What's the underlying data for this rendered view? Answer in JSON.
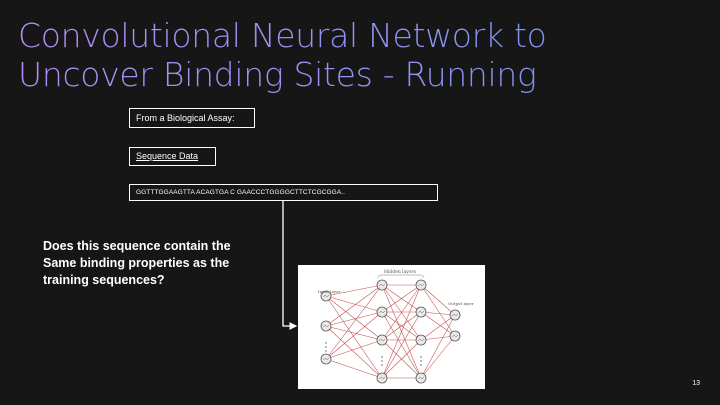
{
  "slide": {
    "title_line1": "Convolutional Neural Network to",
    "title_line2": "Uncover Binding Sites - Running",
    "assay_label": "From a Biological Assay:",
    "sequence_data_label": "Sequence Data",
    "sequence_text": "GGTTTGGAAGTTA  ACAGTGA C GAACCCTGGGGCTTCTCGCGGA..",
    "question": "Does this sequence contain the Same binding properties as the training sequences?",
    "page_number": "13"
  },
  "network_diagram": {
    "hidden_label": "Hidden layers",
    "input_label": "Input layer",
    "output_label": "Output layer",
    "colors": {
      "edge": "#c0504d",
      "node_stroke": "#555555",
      "node_fill": "#e9e9e9",
      "background": "#ffffff"
    }
  },
  "colors": {
    "background": "#161616",
    "title_gradient_start": "#b18cf3",
    "title_gradient_end": "#6f8ff0",
    "text": "#ffffff"
  }
}
